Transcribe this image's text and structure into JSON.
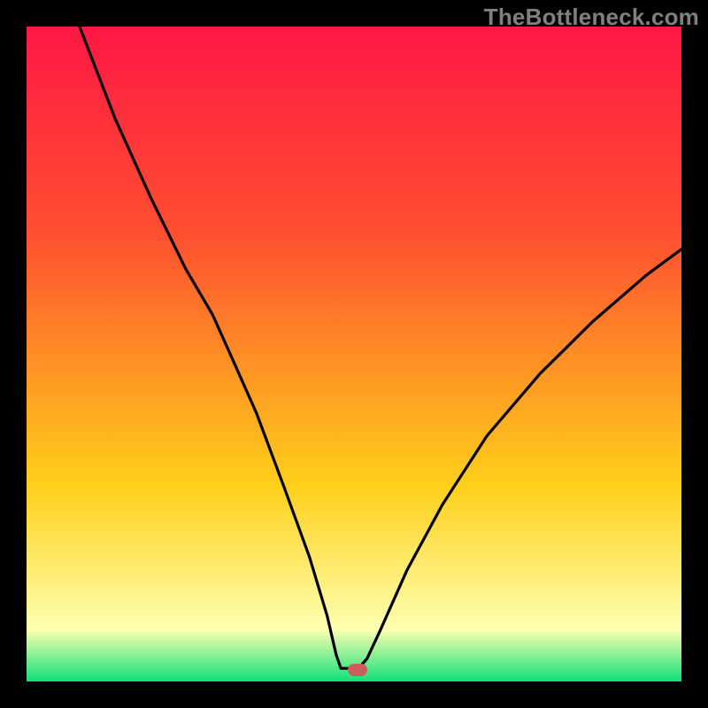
{
  "attribution": "TheBottleneck.com",
  "colors": {
    "frame": "#000000",
    "grad_top": "#ff1744",
    "grad_upper": "#ff5030",
    "grad_mid": "#ffcf1a",
    "grad_cream": "#ffffb0",
    "grad_bottom": "#12e07a",
    "curve": "#000000",
    "marker": "#cd5c5c"
  },
  "marker": {
    "x_frac": 0.505,
    "y_frac": 0.982
  },
  "chart_data": {
    "type": "line",
    "title": "",
    "xlabel": "",
    "ylabel": "",
    "xlim": [
      0,
      100
    ],
    "ylim": [
      0,
      100
    ],
    "series": [
      {
        "name": "curve",
        "points": [
          {
            "x": 8.1,
            "y": 100.0
          },
          {
            "x": 13.5,
            "y": 86.0
          },
          {
            "x": 18.9,
            "y": 74.0
          },
          {
            "x": 24.3,
            "y": 63.0
          },
          {
            "x": 28.4,
            "y": 56.0
          },
          {
            "x": 31.1,
            "y": 50.0
          },
          {
            "x": 35.1,
            "y": 41.0
          },
          {
            "x": 39.2,
            "y": 30.0
          },
          {
            "x": 43.2,
            "y": 19.0
          },
          {
            "x": 45.9,
            "y": 10.0
          },
          {
            "x": 47.3,
            "y": 4.0
          },
          {
            "x": 48.0,
            "y": 2.0
          },
          {
            "x": 50.7,
            "y": 2.0
          },
          {
            "x": 52.0,
            "y": 3.5
          },
          {
            "x": 54.1,
            "y": 8.0
          },
          {
            "x": 58.1,
            "y": 17.0
          },
          {
            "x": 63.5,
            "y": 27.0
          },
          {
            "x": 70.3,
            "y": 37.5
          },
          {
            "x": 78.4,
            "y": 47.0
          },
          {
            "x": 86.5,
            "y": 55.0
          },
          {
            "x": 94.6,
            "y": 62.0
          },
          {
            "x": 100.0,
            "y": 66.0
          }
        ]
      }
    ],
    "optimum": {
      "x": 50.5,
      "y": 1.8
    },
    "note": "Values estimated from unlabeled axes; x and y expressed as percent of visible plot extent, y=0 at bottom."
  }
}
